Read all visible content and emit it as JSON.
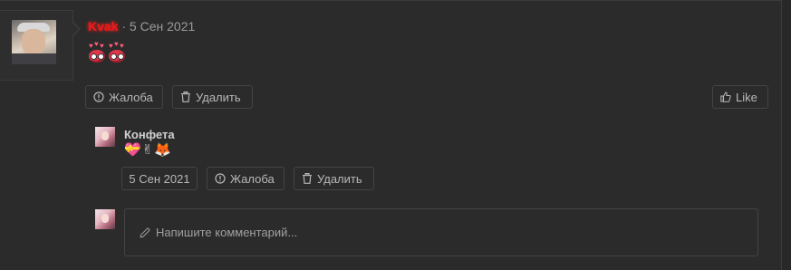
{
  "post": {
    "author": "Kvak",
    "separator": "·",
    "date": "5 Сен 2021",
    "emotes": [
      {
        "name": "love-ball-emote"
      },
      {
        "name": "love-ball-emote"
      }
    ]
  },
  "actions": {
    "report_label": "Жалоба",
    "delete_label": "Удалить",
    "like_label": "Like"
  },
  "reply": {
    "author": "Конфета",
    "text": "💝✌🦊",
    "date": "5 Сен 2021",
    "report_label": "Жалоба",
    "delete_label": "Удалить"
  },
  "comment_input": {
    "placeholder": "Напишите комментарий..."
  },
  "colors": {
    "background": "#2b2b2b",
    "author_highlight": "#e81a1a",
    "border": "#444444",
    "text": "#b8b8b8"
  },
  "icons": [
    "exclamation-circle-icon",
    "trash-icon",
    "thumbs-up-icon",
    "pencil-icon"
  ]
}
